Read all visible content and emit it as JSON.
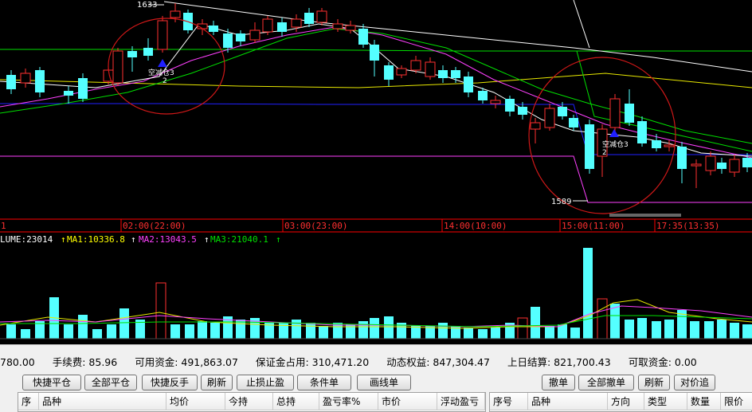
{
  "chart": {
    "price_high_label": "1633",
    "price_low_label": "1589",
    "signals": [
      {
        "label": "空减仓3",
        "sub": "2"
      },
      {
        "label": "空减仓3",
        "sub": "2"
      }
    ],
    "time_axis": [
      "1",
      "02:00(22:00)",
      "03:00(23:00)",
      "14:00(10:00)",
      "15:00(11:00)",
      "17:35(13:35)"
    ],
    "volume_legend": {
      "volume": "LUME:23014",
      "ma1": "MA1:10336.8",
      "ma2": "MA2:13043.5",
      "ma3": "MA3:21040.1"
    },
    "colors": {
      "bull": "#ff3030",
      "bear": "#54ffff",
      "ma_short": "#ffffff",
      "ma_mid": "#ff40ff",
      "ma_long": "#00e000",
      "ma_yellow": "#e8e800",
      "axis": "#ff0000",
      "signal": "#2020ff"
    }
  },
  "account": {
    "balance_tail": "780.00",
    "fee": "手续费: 85.96",
    "available": "可用资金: 491,863.07",
    "margin": "保证金占用: 310,471.20",
    "equity": "动态权益: 847,304.47",
    "last_settle": "上日结算: 821,700.43",
    "withdrawable": "可取资金: 0.00"
  },
  "toolbar": {
    "quick_close": "快捷平仓",
    "close_all": "全部平仓",
    "quick_reverse": "快捷反手",
    "refresh": "刷新",
    "stop_loss_profit": "止损止盈",
    "conditional_order": "条件单",
    "line_order": "画线单",
    "cancel": "撤单",
    "cancel_all": "全部撤单",
    "refresh2": "刷新",
    "counter_price_chase": "对价追"
  },
  "positions_table": {
    "headers": [
      "序",
      "品种",
      "均价",
      "今持",
      "总持",
      "盈亏率%",
      "市价",
      "浮动盈亏"
    ]
  },
  "orders_table": {
    "headers": [
      "序号",
      "品种",
      "方向",
      "类型",
      "数量",
      "限价"
    ]
  }
}
